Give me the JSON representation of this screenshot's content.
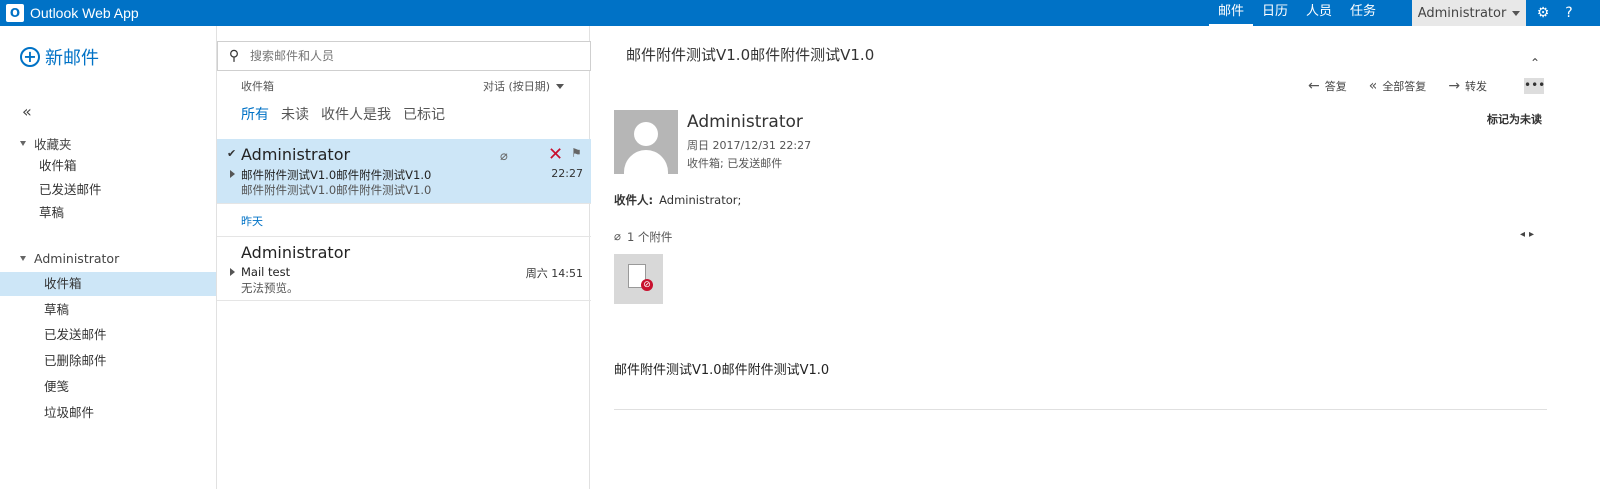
{
  "app": {
    "title": "Outlook Web App",
    "logo": "O"
  },
  "topnav": {
    "items": [
      "邮件",
      "日历",
      "人员",
      "任务"
    ],
    "active_index": 0
  },
  "user": {
    "name": "Administrator"
  },
  "icons": {
    "settings": "⚙",
    "help": "?"
  },
  "leftnav": {
    "new_mail": "新邮件",
    "favorites": {
      "header": "收藏夹",
      "items": [
        "收件箱",
        "已发送邮件",
        "草稿"
      ]
    },
    "account": {
      "header": "Administrator",
      "items": [
        "收件箱",
        "草稿",
        "已发送邮件",
        "已删除邮件",
        "便笺",
        "垃圾邮件"
      ],
      "selected_index": 0
    }
  },
  "list": {
    "search_placeholder": "搜索邮件和人员",
    "folder": "收件箱",
    "sort": "对话 (按日期)",
    "filters": [
      "所有",
      "未读",
      "收件人是我",
      "已标记"
    ],
    "active_filter": 0,
    "date_group": "昨天",
    "items": [
      {
        "sender": "Administrator",
        "subject": "邮件附件测试V1.0邮件附件测试V1.0",
        "preview": "邮件附件测试V1.0邮件附件测试V1.0",
        "time": "22:27",
        "selected": true,
        "has_attachment": true
      },
      {
        "sender": "Administrator",
        "subject": "Mail test",
        "preview": "无法预览。",
        "time": "周六 14:51",
        "selected": false,
        "has_attachment": false
      }
    ]
  },
  "reading": {
    "subject": "邮件附件测试V1.0邮件附件测试V1.0",
    "actions": {
      "reply": "答复",
      "reply_all": "全部答复",
      "forward": "转发"
    },
    "mark_unread": "标记为未读",
    "from": "Administrator",
    "date": "周日 2017/12/31 22:27",
    "folders": "收件箱; 已发送邮件",
    "to_label": "收件人:",
    "to_value": "Administrator;",
    "attachment_count": "1 个附件",
    "body": "邮件附件测试V1.0邮件附件测试V1.0"
  },
  "colors": {
    "brand": "#0072c6",
    "selection": "#cde6f7",
    "delete": "#c8102e"
  }
}
